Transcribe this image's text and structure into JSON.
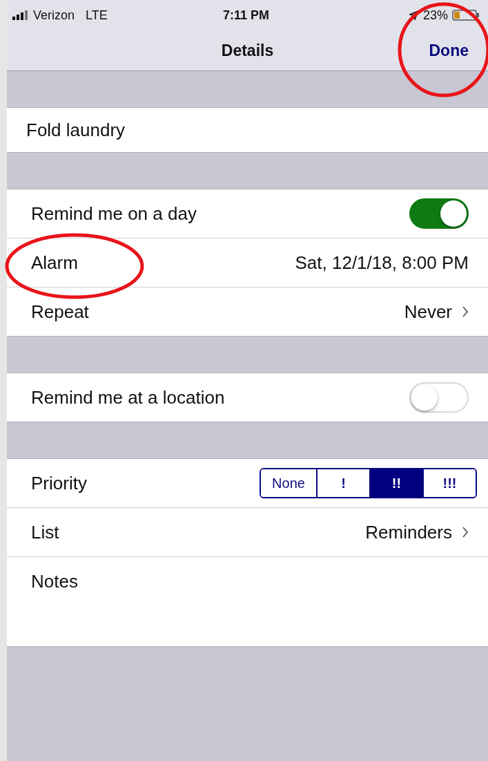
{
  "status_bar": {
    "carrier": "Verizon",
    "network": "LTE",
    "time": "7:11 PM",
    "battery": "23%"
  },
  "nav": {
    "title": "Details",
    "done": "Done"
  },
  "task": {
    "title": "Fold laundry"
  },
  "reminder_day": [
    {
      "kind": "toggle",
      "label": "Remind me on a day",
      "on": true
    },
    {
      "kind": "value",
      "label": "Alarm",
      "value": "Sat, 12/1/18, 8:00 PM",
      "chevron": false
    },
    {
      "kind": "value",
      "label": "Repeat",
      "value": "Never",
      "chevron": true
    }
  ],
  "reminder_location": [
    {
      "kind": "toggle",
      "label": "Remind me at a location",
      "on": false
    }
  ],
  "details": [
    {
      "kind": "priority",
      "label": "Priority",
      "options": [
        {
          "label": "None",
          "selected": false
        },
        {
          "label": "!",
          "selected": false
        },
        {
          "label": "!!",
          "selected": true
        },
        {
          "label": "!!!",
          "selected": false
        }
      ]
    },
    {
      "kind": "value",
      "label": "List",
      "value": "Reminders",
      "chevron": true
    },
    {
      "kind": "notes",
      "label": "Notes"
    }
  ]
}
